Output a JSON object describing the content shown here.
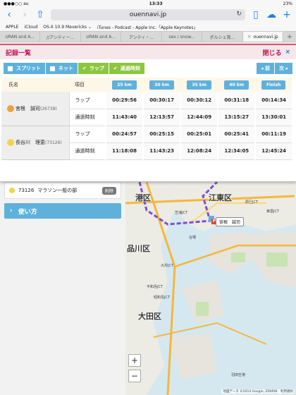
{
  "status": {
    "carrier": "●●●○○ au",
    "time": "13:33",
    "battery": "23%"
  },
  "browser": {
    "url": "ouennavi.jp",
    "bookmarks": [
      "APPLE",
      "iCloud",
      "OS-X 10.9 Mavericks ⌄",
      "iTunes - Podcast - Apple Inc.「Apple Keynotes」"
    ],
    "tabs": [
      {
        "label": "URAN and A..."
      },
      {
        "label": "//アンティー..."
      },
      {
        "label": "URAN and A..."
      },
      {
        "label": "アンティ・..."
      },
      {
        "label": "sex / snow..."
      },
      {
        "label": "ポルシェ賞..."
      },
      {
        "label": "ouennavi.jp"
      }
    ]
  },
  "panel": {
    "title": "記録一覧",
    "close_label": "閉じる",
    "toolbar": {
      "split": "スプリット",
      "net": "ネット",
      "lap": "ラップ",
      "pass_time": "通過時刻",
      "prev": "◂ 前",
      "next": "次 ▸"
    },
    "table": {
      "name_header": "氏名",
      "item_header": "項目",
      "checkpoints": [
        "25 km",
        "30 km",
        "35 km",
        "40 km",
        "Finish"
      ],
      "runners": [
        {
          "name": "宮根　誠司",
          "number": "(26738)",
          "dot_color": "#f0a040",
          "rows": [
            {
              "label": "ラップ",
              "values": [
                "00:29:56",
                "00:30:17",
                "00:30:12",
                "00:31:18",
                "00:14:34"
              ]
            },
            {
              "label": "通過時刻",
              "values": [
                "11:43:40",
                "12:13:57",
                "12:44:09",
                "13:15:27",
                "13:30:01"
              ]
            }
          ]
        },
        {
          "name": "長谷川　理恵",
          "number": "(73126)",
          "dot_color": "#f5d34a",
          "rows": [
            {
              "label": "ラップ",
              "values": [
                "00:24:57",
                "00:25:15",
                "00:25:01",
                "00:25:41",
                "00:11:19"
              ]
            },
            {
              "label": "通過時刻",
              "values": [
                "11:18:08",
                "11:43:23",
                "12:08:24",
                "12:34:05",
                "12:45:24"
              ]
            }
          ]
        }
      ]
    }
  },
  "sidebar": {
    "entry": {
      "number": "73126",
      "category": "マラソン一般の部",
      "delete_label": "削除",
      "name_partial": "長谷川　理恵"
    },
    "howto_label": "使い方"
  },
  "map": {
    "wards": [
      "港区",
      "江東区",
      "品川区",
      "大田区"
    ],
    "popup_label": "宮根　誠司",
    "labels": [
      "辰巳JCT",
      "東雲JCT",
      "芝浦JCT",
      "台場",
      "大井JCT",
      "平和島JCT",
      "昭和島JCT",
      "羽田空港"
    ],
    "attribution": "地図データ ©2014 Google, ZENRIN　利用規約",
    "zoom_in": "+",
    "zoom_out": "−"
  }
}
